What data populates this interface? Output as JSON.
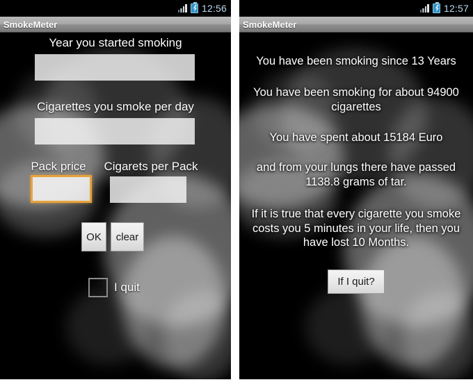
{
  "left_screen": {
    "status_bar": {
      "time": "12:56",
      "signal_icon": "signal-bars-icon",
      "battery_icon": "battery-charging-icon"
    },
    "title_bar": {
      "app_title": "SmokeMeter"
    },
    "form": {
      "year_label": "Year you started smoking",
      "year_value": "",
      "year_placeholder": "",
      "per_day_label": "Cigarettes you smoke per day",
      "per_day_value": "",
      "per_day_placeholder": "",
      "pack_price_label": "Pack price",
      "pack_price_value": "",
      "pack_price_placeholder": "",
      "per_pack_label": "Cigarets per Pack",
      "per_pack_value": "",
      "per_pack_placeholder": "",
      "ok_button": "OK",
      "clear_button": "clear",
      "quit_checkbox_label": "I quit",
      "quit_checkbox_checked": false,
      "focus_color": "#e8a33d"
    }
  },
  "right_screen": {
    "status_bar": {
      "time": "12:57",
      "signal_icon": "signal-bars-icon",
      "battery_icon": "battery-charging-icon"
    },
    "title_bar": {
      "app_title": "SmokeMeter"
    },
    "results": {
      "line_1": "You have been smoking since 13 Years",
      "line_2": "You have been smoking for about 94900 cigarettes",
      "line_3": "You have spent about 15184 Euro",
      "line_4": "and from your lungs there have passed 1138.8 grams of tar.",
      "line_5": "If it is true that every cigarette you smoke costs you 5 minutes in your life, then you have lost 10 Months.",
      "quit_button": "If I quit?"
    }
  },
  "theme": {
    "background_color": "#000000",
    "text_color": "#ffffff",
    "clock_color": "#b9d9ee",
    "titlebar_color": "#a9a9a9"
  }
}
